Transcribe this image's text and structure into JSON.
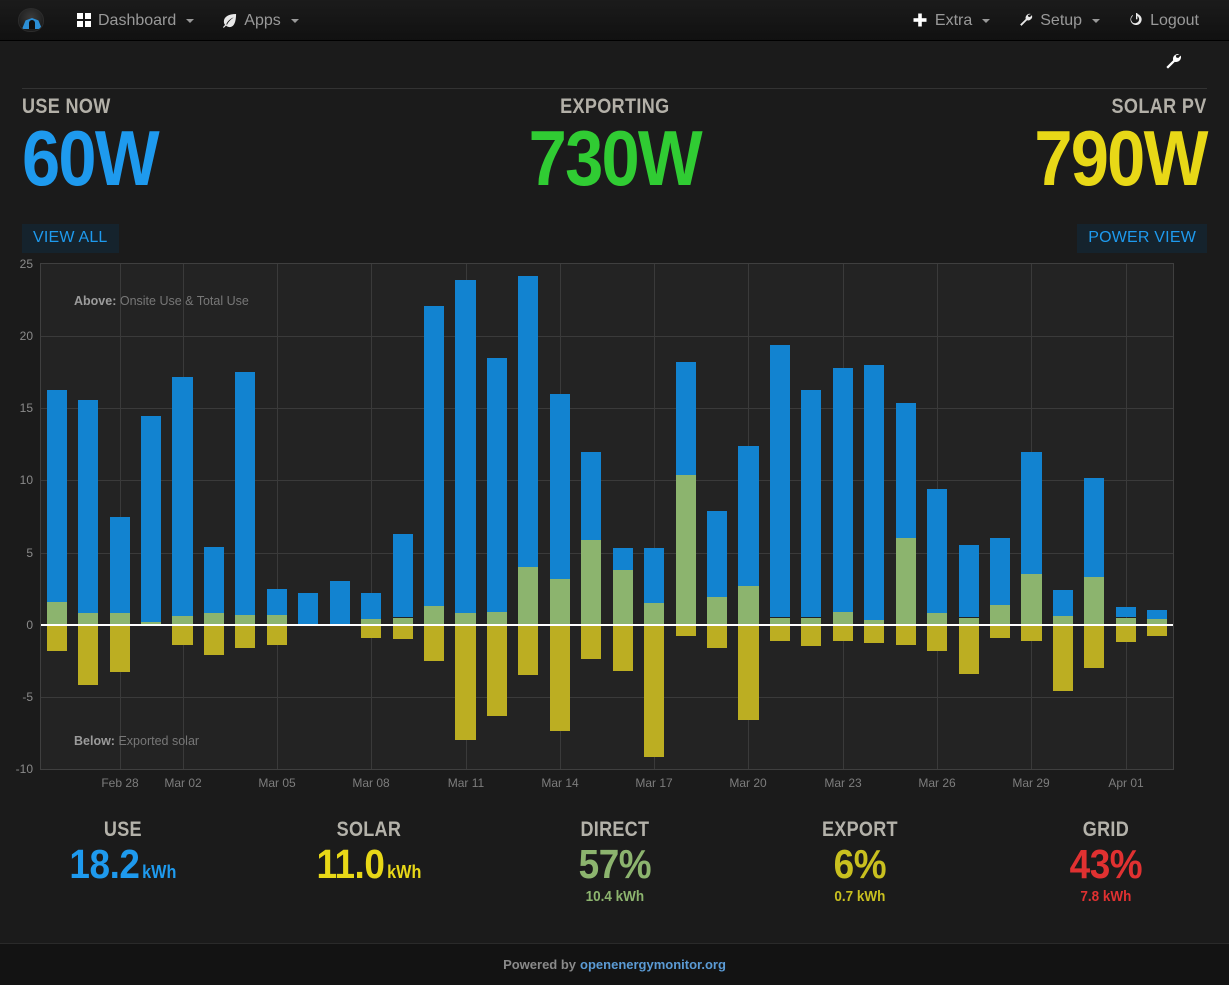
{
  "navbar": {
    "brand_name": "emoncms-logo",
    "left_items": [
      {
        "label": "Dashboard",
        "icon": "grid-icon",
        "caret": true
      },
      {
        "label": "Apps",
        "icon": "leaf-icon",
        "caret": true
      }
    ],
    "right_items": [
      {
        "label": "Extra",
        "icon": "plus-icon",
        "caret": true
      },
      {
        "label": "Setup",
        "icon": "wrench-icon",
        "caret": true
      },
      {
        "label": "Logout",
        "icon": "power-icon",
        "caret": false
      }
    ]
  },
  "toolstrip": {
    "config_icon": "wrench-icon"
  },
  "summary": [
    {
      "label": "USE NOW",
      "value": "60W",
      "color": "#1e9aee"
    },
    {
      "label": "EXPORTING",
      "value": "730W",
      "color": "#30cc33"
    },
    {
      "label": "SOLAR PV",
      "value": "790W",
      "color": "#e8d817"
    }
  ],
  "buttons": {
    "view_all": "VIEW ALL",
    "power_view": "POWER VIEW"
  },
  "notes": {
    "above_prefix": "Above:",
    "above_text": " Onsite Use & Total Use",
    "below_prefix": "Below:",
    "below_text": " Exported solar"
  },
  "stats": [
    {
      "label": "USE",
      "value": "18.2",
      "unit": "kWh",
      "sub": "",
      "color": "#1e9aee"
    },
    {
      "label": "SOLAR",
      "value": "11.0",
      "unit": "kWh",
      "sub": "",
      "color": "#e8d817"
    },
    {
      "label": "DIRECT",
      "value": "57%",
      "unit": "",
      "sub": "10.4 kWh",
      "color": "#8cb46e"
    },
    {
      "label": "EXPORT",
      "value": "6%",
      "unit": "",
      "sub": "0.7 kWh",
      "color": "#c9c01f"
    },
    {
      "label": "GRID",
      "value": "43%",
      "unit": "",
      "sub": "7.8 kWh",
      "color": "#e03131"
    }
  ],
  "footer": {
    "text": "Powered by",
    "link": "openenergymonitor.org"
  },
  "chart_data": {
    "type": "bar",
    "title": "",
    "subtitle": "",
    "xlabel": "",
    "ylabel": "",
    "stacked": true,
    "grid": true,
    "legend_position": "none",
    "ylim": [
      -10,
      25
    ],
    "yticks": [
      25,
      20,
      15,
      10,
      5,
      0,
      -5,
      -10
    ],
    "xticks": [
      "Feb 28",
      "Mar 02",
      "Mar 05",
      "Mar 08",
      "Mar 11",
      "Mar 14",
      "Mar 17",
      "Mar 20",
      "Mar 23",
      "Mar 26",
      "Mar 29",
      "Apr 01"
    ],
    "xtick_index": [
      2,
      4,
      7,
      10,
      13,
      16,
      19,
      22,
      25,
      28,
      31,
      34
    ],
    "colors": {
      "grid_use": "#1283d0",
      "direct_solar": "#8cb46e",
      "exported_solar": "#bcae22"
    },
    "series": [
      {
        "name": "Onsite Use (direct solar)",
        "key": "direct_solar",
        "color": "#8cb46e",
        "values": [
          1.6,
          0.8,
          0.8,
          0.2,
          0.6,
          0.8,
          0.7,
          0.7,
          0.0,
          0.0,
          0.4,
          0.5,
          1.3,
          0.8,
          0.9,
          4.0,
          3.2,
          5.9,
          3.8,
          1.5,
          10.4,
          1.9,
          2.7,
          0.5,
          0.5,
          0.9,
          0.3,
          6.0,
          0.8,
          0.5,
          1.4,
          3.5,
          0.6,
          3.3,
          0.5,
          0.4
        ]
      },
      {
        "name": "Total Use (grid)",
        "key": "grid_use",
        "color": "#1283d0",
        "values": [
          14.7,
          14.8,
          6.7,
          14.3,
          16.6,
          4.6,
          16.8,
          1.8,
          2.2,
          3.0,
          1.8,
          5.8,
          20.8,
          23.1,
          17.6,
          20.2,
          12.8,
          6.1,
          1.5,
          3.8,
          7.8,
          6.0,
          9.7,
          18.9,
          15.8,
          16.9,
          17.7,
          9.4,
          8.6,
          5.0,
          4.6,
          8.5,
          1.8,
          6.9,
          0.7,
          0.6
        ]
      },
      {
        "name": "Exported solar",
        "key": "exported_solar",
        "color": "#bcae22",
        "values": [
          -1.8,
          -4.2,
          -3.3,
          0.0,
          -1.4,
          -2.1,
          -1.6,
          -1.4,
          0.0,
          0.0,
          -0.9,
          -1.0,
          -2.5,
          -8.0,
          -6.3,
          -3.5,
          -7.4,
          -2.4,
          -3.2,
          -9.2,
          -0.8,
          -1.6,
          -6.6,
          -1.1,
          -1.5,
          -1.1,
          -1.3,
          -1.4,
          -1.8,
          -3.4,
          -0.9,
          -1.1,
          -4.6,
          -3.0,
          -1.2,
          -0.8
        ]
      }
    ]
  }
}
